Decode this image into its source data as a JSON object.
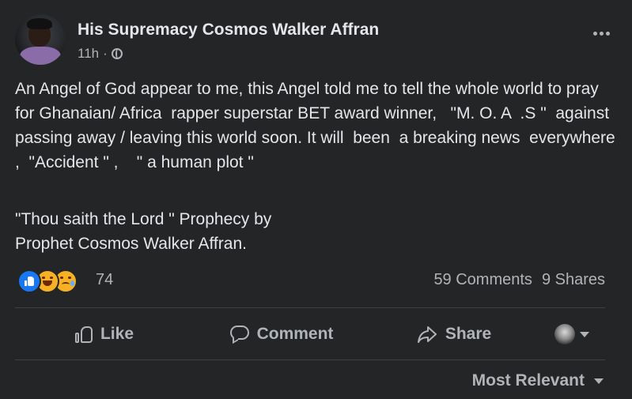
{
  "post": {
    "author": "His Supremacy Cosmos Walker Affran",
    "time": "11h",
    "separator": "·",
    "privacy_icon": "globe-icon",
    "more_icon": "more-horizontal-icon",
    "body": "An Angel of God appear to me, this Angel told me to tell the whole world to pray for Ghanaian/ Africa  rapper superstar BET award winner,   \"M. O. A  .S \"  against passing away / leaving this world soon. It will  been  a breaking news  everywhere  ,  \"Accident \" ,    \" a human plot \"",
    "body2": "\"Thou saith the Lord \" Prophecy by\nProphet Cosmos Walker Affran."
  },
  "stats": {
    "reaction_icons": [
      "like-icon",
      "haha-icon",
      "sad-icon"
    ],
    "reaction_count": "74",
    "comments": "59 Comments",
    "shares": "9 Shares"
  },
  "actions": {
    "like": "Like",
    "comment": "Comment",
    "share": "Share"
  },
  "comments_sort": {
    "label": "Most Relevant"
  },
  "colors": {
    "background": "#242526",
    "text": "#e4e6eb",
    "muted": "#b0b3b8",
    "like_blue": "#1877f2",
    "emoji_yellow": "#f7b125"
  }
}
